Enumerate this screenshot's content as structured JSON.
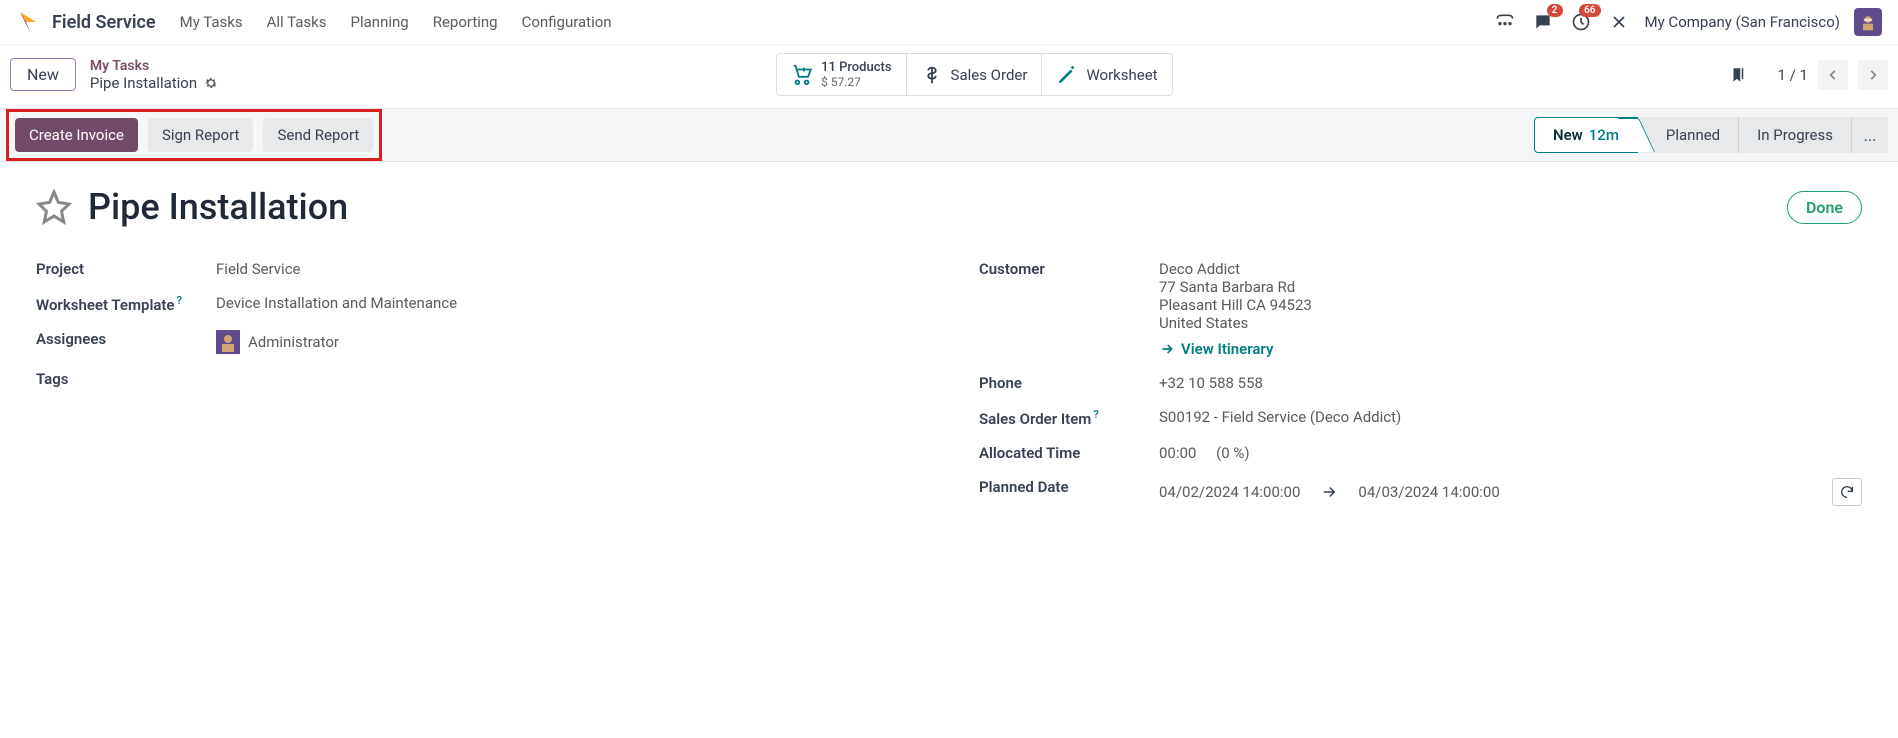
{
  "app": {
    "title": "Field Service"
  },
  "nav": {
    "items": [
      "My Tasks",
      "All Tasks",
      "Planning",
      "Reporting",
      "Configuration"
    ]
  },
  "topbar": {
    "chat_badge": "2",
    "activity_badge": "66",
    "company": "My Company (San Francisco)"
  },
  "control": {
    "new_label": "New",
    "breadcrumb_top": "My Tasks",
    "breadcrumb_sub": "Pipe Installation",
    "products_count": "11 Products",
    "products_amount": "$ 57.27",
    "sales_order_label": "Sales Order",
    "worksheet_label": "Worksheet",
    "pagecount": "1 / 1"
  },
  "actions": {
    "create_invoice": "Create Invoice",
    "sign_report": "Sign Report",
    "send_report": "Send Report"
  },
  "status": {
    "new": "New",
    "new_timer": "12m",
    "planned": "Planned",
    "in_progress": "In Progress",
    "more": "..."
  },
  "task": {
    "title": "Pipe Installation",
    "done_label": "Done",
    "labels": {
      "project": "Project",
      "worksheet_template": "Worksheet Template",
      "assignees": "Assignees",
      "tags": "Tags",
      "customer": "Customer",
      "phone": "Phone",
      "sales_order_item": "Sales Order Item",
      "allocated_time": "Allocated Time",
      "planned_date": "Planned Date"
    },
    "project": "Field Service",
    "worksheet_template": "Device Installation and Maintenance",
    "assignee": "Administrator",
    "tags": "",
    "customer": {
      "name": "Deco Addict",
      "street": "77 Santa Barbara Rd",
      "city": "Pleasant Hill CA 94523",
      "country": "United States",
      "itinerary": "View Itinerary"
    },
    "phone": "+32 10 588 558",
    "sales_order_item": "S00192 - Field Service (Deco Addict)",
    "allocated_time": "00:00",
    "allocated_pct": "(0 %)",
    "planned_start": "04/02/2024 14:00:00",
    "planned_end": "04/03/2024 14:00:00"
  }
}
